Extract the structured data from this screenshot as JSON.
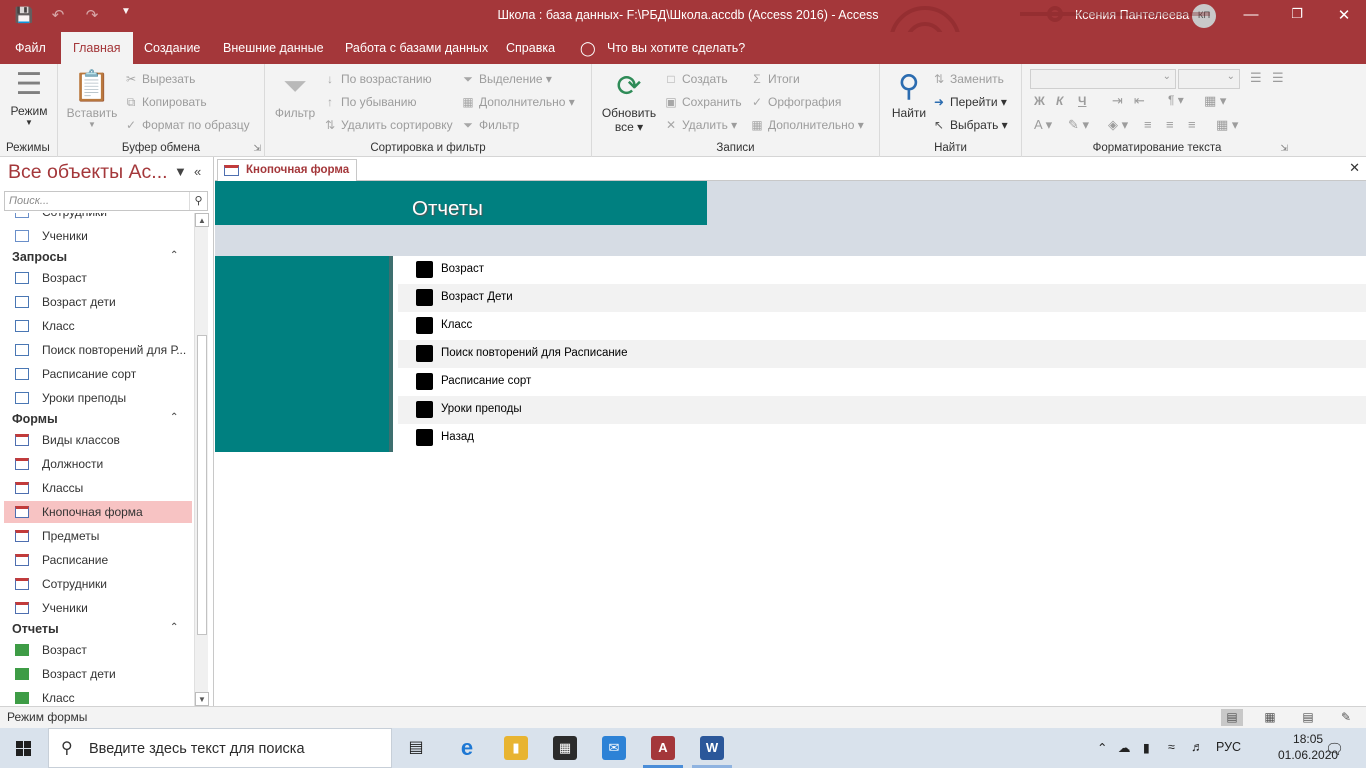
{
  "window": {
    "title": "Школа : база данных- F:\\РБД\\Школа.accdb (Access 2016)  -  Access",
    "user": "Ксения Пантелеева",
    "avatar": "КП"
  },
  "menu": [
    "Файл",
    "Главная",
    "Создание",
    "Внешние данные",
    "Работа с базами данных",
    "Справка",
    "Что вы хотите сделать?"
  ],
  "ribbon": {
    "views": {
      "mode": "Режим",
      "group": "Режимы"
    },
    "clipboard": {
      "paste": "Вставить",
      "cut": "Вырезать",
      "copy": "Копировать",
      "format_painter": "Формат по образцу",
      "group": "Буфер обмена"
    },
    "sort": {
      "filter": "Фильтр",
      "asc": "По возрастанию",
      "desc": "По убыванию",
      "remove": "Удалить сортировку",
      "selection": "Выделение",
      "advanced": "Дополнительно",
      "toggle": "Фильтр",
      "group": "Сортировка и фильтр"
    },
    "records": {
      "refresh_1": "Обновить",
      "refresh_2": "все",
      "new": "Создать",
      "save": "Сохранить",
      "delete": "Удалить",
      "totals": "Итоги",
      "spelling": "Орфография",
      "more": "Дополнительно",
      "group": "Записи"
    },
    "find": {
      "find": "Найти",
      "replace": "Заменить",
      "goto": "Перейти",
      "select": "Выбрать",
      "group": "Найти"
    },
    "text": {
      "bold": "Ж",
      "italic": "К",
      "underline": "Ч",
      "group": "Форматирование текста"
    }
  },
  "nav": {
    "header": "Все объекты Ac...",
    "search_placeholder": "Поиск...",
    "top_partial": "Сотрудники",
    "top_item": "Ученики",
    "sections": {
      "queries": "Запросы",
      "forms": "Формы",
      "reports": "Отчеты"
    },
    "queries": [
      "Возраст",
      "Возраст дети",
      "Класс",
      "Поиск повторений для Р...",
      "Расписание сорт",
      "Уроки преподы"
    ],
    "forms": [
      "Виды классов",
      "Должности",
      "Классы",
      "Кнопочная форма",
      "Предметы",
      "Расписание",
      "Сотрудники",
      "Ученики"
    ],
    "reports": [
      "Возраст",
      "Возраст дети",
      "Класс"
    ]
  },
  "doc": {
    "tab": "Кнопочная форма",
    "form_title": "Отчеты",
    "buttons": [
      "Возраст",
      "Возраст Дети",
      "Класс",
      "Поиск повторений для Расписание",
      "Расписание сорт",
      "Уроки преподы",
      "Назад"
    ]
  },
  "status": {
    "text": "Режим формы"
  },
  "taskbar": {
    "search": "Введите здесь текст для поиска",
    "lang": "РУС",
    "time": "18:05",
    "date": "01.06.2020"
  },
  "colors": {
    "access_red": "#a4373a",
    "teal": "#008080",
    "header_band": "#d6dce4",
    "selected_nav": "#f7c3c3"
  }
}
